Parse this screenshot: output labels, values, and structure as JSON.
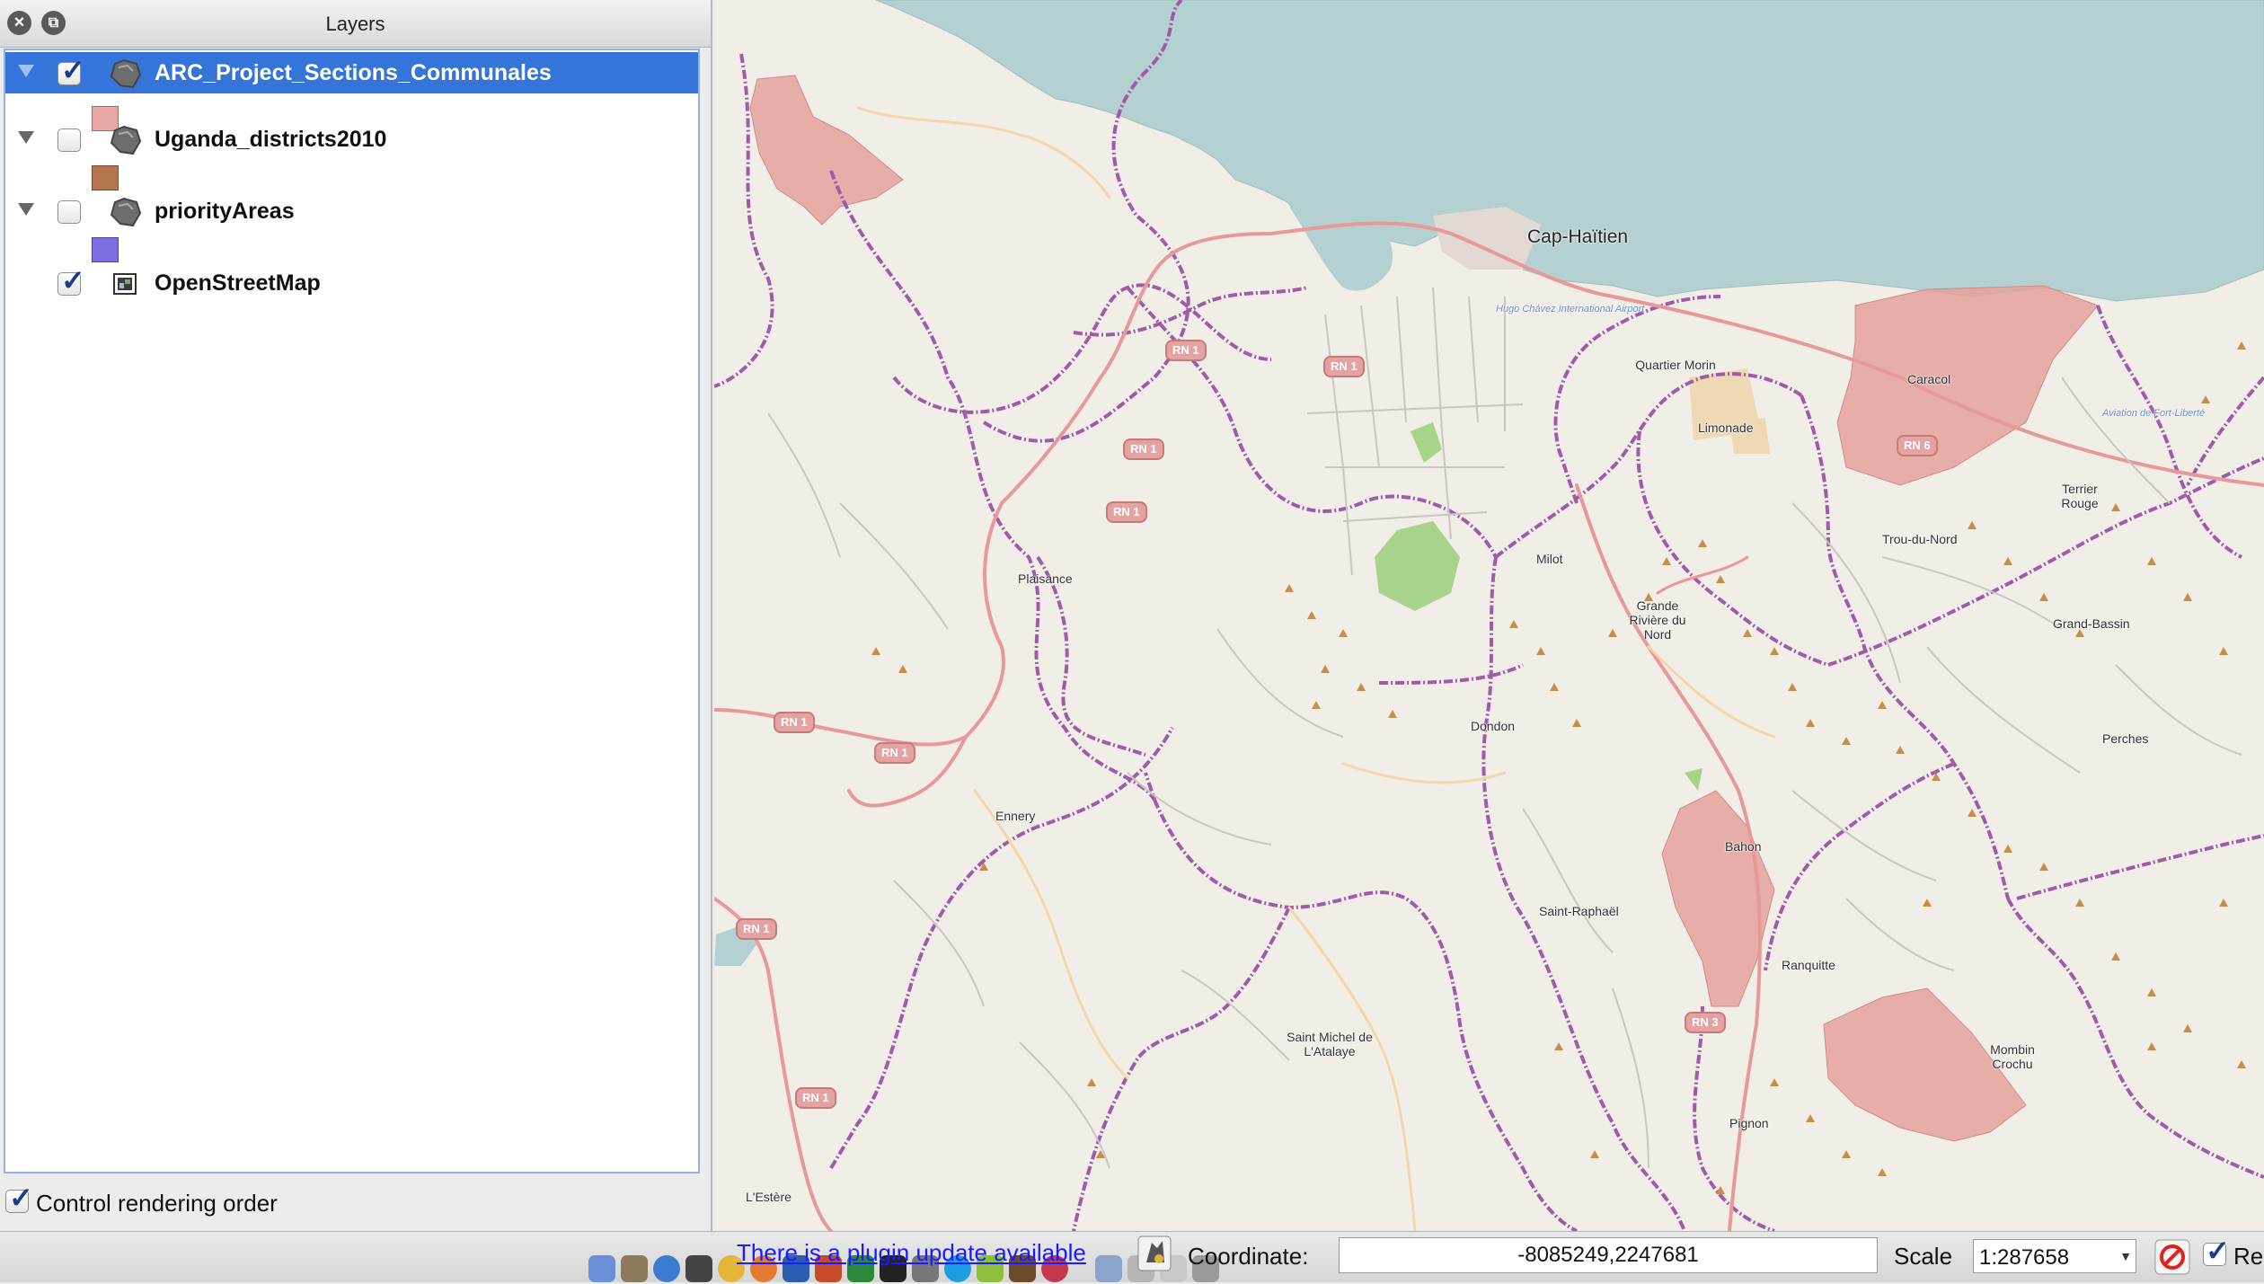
{
  "panel": {
    "title": "Layers",
    "layers": [
      {
        "name": "ARC_Project_Sections_Communales",
        "checked": true,
        "expanded": true,
        "selected": true,
        "swatch": "#e8a9a5"
      },
      {
        "name": "Uganda_districts2010",
        "checked": false,
        "expanded": true,
        "selected": false,
        "swatch": "#b4754f"
      },
      {
        "name": "priorityAreas",
        "checked": false,
        "expanded": true,
        "selected": false,
        "swatch": "#7a6ee0"
      },
      {
        "name": "OpenStreetMap",
        "checked": true,
        "expanded": false,
        "selected": false
      }
    ],
    "control_rendering_order": {
      "label": "Control rendering order",
      "checked": true
    }
  },
  "map": {
    "sea_color": "#b5d0d0",
    "land_color": "#f1eee8",
    "region_color": "#e8a9a5",
    "places": [
      {
        "name": "Cap-Haïtien",
        "kind": "city"
      },
      {
        "name": "Hugo Chávez International Airport",
        "kind": "airport"
      },
      {
        "name": "Quartier Morin",
        "kind": "town"
      },
      {
        "name": "Limonade",
        "kind": "town"
      },
      {
        "name": "Caracol",
        "kind": "town"
      },
      {
        "name": "Aviation de Fort-Liberté",
        "kind": "airport"
      },
      {
        "name": "Terrier Rouge",
        "kind": "town"
      },
      {
        "name": "Trou-du-Nord",
        "kind": "town"
      },
      {
        "name": "Milot",
        "kind": "town"
      },
      {
        "name": "Grande Rivière du Nord",
        "kind": "town"
      },
      {
        "name": "Grand-Bassin",
        "kind": "town"
      },
      {
        "name": "Plaisance",
        "kind": "town"
      },
      {
        "name": "Dondon",
        "kind": "town"
      },
      {
        "name": "Perches",
        "kind": "town"
      },
      {
        "name": "Ennery",
        "kind": "town"
      },
      {
        "name": "Bahon",
        "kind": "town"
      },
      {
        "name": "Saint-Raphaël",
        "kind": "town"
      },
      {
        "name": "Ranquitte",
        "kind": "town"
      },
      {
        "name": "Saint Michel de L'Atalaye",
        "kind": "town"
      },
      {
        "name": "Mombin Crochu",
        "kind": "town"
      },
      {
        "name": "Pignon",
        "kind": "town"
      },
      {
        "name": "L'Estère",
        "kind": "town"
      }
    ],
    "shields": [
      "RN 1",
      "RN 1",
      "RN 1",
      "RN 1",
      "RN 1",
      "RN 1",
      "RN 1",
      "RN 1",
      "RN 6",
      "RN 3"
    ]
  },
  "statusbar": {
    "plugin_message": "There is a plugin update available",
    "coordinate_label": "Coordinate:",
    "coordinate_value": "-8085249,2247681",
    "scale_label": "Scale",
    "scale_value": "1:287658",
    "render_label": "Render",
    "render_checked": true
  }
}
